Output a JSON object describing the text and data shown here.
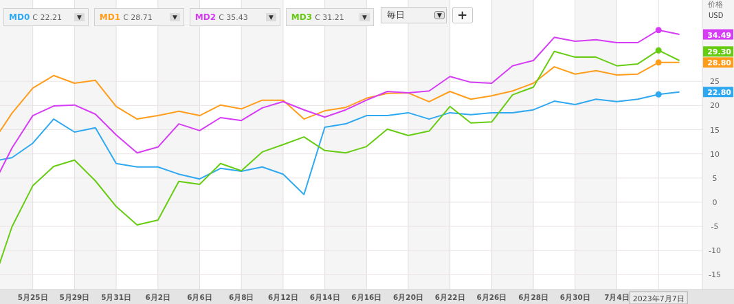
{
  "legend": [
    {
      "close": "C 22.21",
      "toggle": "▼"
    },
    {
      "close": "C 28.71",
      "toggle": "▼"
    },
    {
      "close": "C 35.43",
      "toggle": "▼"
    },
    {
      "close": "C 31.21",
      "toggle": "▼"
    }
  ],
  "period": {
    "value": "毎日",
    "toggle": "▼"
  },
  "add_button": "+",
  "unit_label": "USD",
  "price_tags": [
    {
      "text": "34.49",
      "color": "#d63cf5"
    },
    {
      "text": "29.30",
      "color": "#66cc11"
    },
    {
      "text": "28.80",
      "color": "#ff9c1a"
    },
    {
      "text": "22.80",
      "color": "#2ea8f0"
    }
  ],
  "crosshair_label": "2023年7月7日",
  "chart_data": {
    "type": "line",
    "ylabel": "价格",
    "categories": [
      null,
      null,
      "5月25日",
      null,
      "5月29日",
      null,
      "5月31日",
      null,
      "6月2日",
      null,
      "6月6日",
      null,
      "6月8日",
      null,
      "6月12日",
      null,
      "6月14日",
      null,
      "6月16日",
      null,
      "6月20日",
      null,
      "6月22日",
      null,
      "6月26日",
      null,
      "6月28日",
      null,
      "6月30日",
      null,
      "7月4日",
      null,
      null,
      null
    ],
    "ylim": [
      -18.07,
      41.82
    ],
    "grid": true,
    "yticks": [
      -15,
      -10,
      -5,
      0,
      5,
      10,
      15,
      20,
      25
    ],
    "series": [
      {
        "name": "MD0",
        "color": "#2ea8f0",
        "values": [
          8.4,
          9.2,
          12.2,
          17.2,
          14.5,
          15.4,
          8.0,
          7.3,
          7.3,
          5.8,
          4.8,
          7.0,
          6.4,
          7.3,
          5.8,
          1.6,
          15.5,
          16.2,
          17.9,
          17.9,
          18.5,
          17.2,
          18.5,
          18.1,
          18.5,
          18.5,
          19.1,
          20.9,
          20.2,
          21.3,
          20.8,
          21.3,
          22.3,
          22.8
        ]
      },
      {
        "name": "MD1",
        "color": "#ff9c1a",
        "values": [
          11.9,
          18.4,
          23.6,
          26.2,
          24.6,
          25.2,
          19.8,
          17.2,
          17.9,
          18.8,
          17.9,
          20.1,
          19.3,
          21.1,
          21.1,
          17.2,
          18.9,
          19.6,
          21.5,
          22.5,
          22.6,
          20.8,
          22.9,
          21.3,
          22.0,
          23.0,
          24.6,
          28.0,
          26.5,
          27.2,
          26.3,
          26.5,
          28.9,
          28.9
        ]
      },
      {
        "name": "MD2",
        "color": "#d63cf5",
        "values": [
          2.7,
          11.2,
          17.9,
          19.9,
          20.1,
          18.2,
          13.9,
          10.2,
          11.4,
          16.2,
          14.8,
          17.5,
          16.9,
          19.5,
          20.8,
          19.1,
          17.6,
          19.1,
          21.1,
          22.9,
          22.6,
          23.0,
          26.0,
          24.8,
          24.6,
          28.2,
          29.3,
          34.1,
          33.3,
          33.6,
          33.0,
          33.0,
          35.6,
          34.7
        ]
      },
      {
        "name": "MD3",
        "color": "#66cc11",
        "values": [
          -17.9,
          -5.1,
          3.4,
          7.4,
          8.7,
          4.4,
          -0.9,
          -4.7,
          -3.7,
          4.3,
          3.7,
          8.0,
          6.5,
          10.4,
          11.9,
          13.5,
          10.7,
          10.2,
          11.5,
          15.1,
          13.8,
          14.7,
          19.8,
          16.4,
          16.6,
          22.2,
          23.8,
          31.2,
          30.0,
          30.0,
          28.2,
          28.6,
          31.4,
          29.3
        ]
      }
    ]
  }
}
